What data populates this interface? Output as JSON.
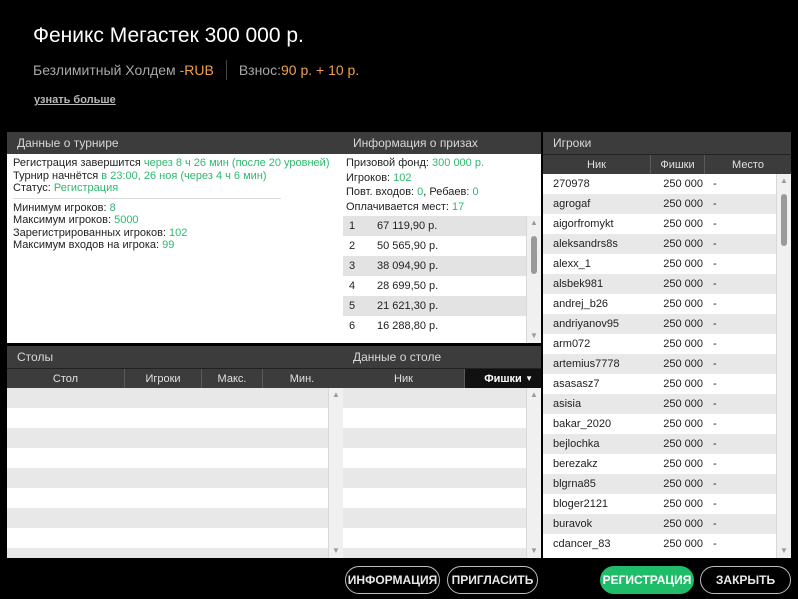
{
  "header": {
    "title": "Феникс Мегастек 300 000 р.",
    "game_type": "Безлимитный Холдем - ",
    "currency": "RUB",
    "buyin_label": "Взнос: ",
    "buyin_value": "90 р. + 10 р.",
    "more_link": "узнать больше"
  },
  "tournament": {
    "heading": "Данные о турнире",
    "reg_label": "Регистрация завершится ",
    "reg_value": "через 8 ч 26 мин (после 20 уровней)",
    "start_label": "Турнир начнётся ",
    "start_value": "в 23:00, 26 ноя (через 4 ч 6 мин)",
    "status_label": "Статус: ",
    "status_value": "Регистрация",
    "min_label": "Минимум игроков: ",
    "min_value": "8",
    "max_label": "Максимум игроков: ",
    "max_value": "5000",
    "registered_label": "Зарегистрированных игроков: ",
    "registered_value": "102",
    "max_entries_label": "Максимум входов на игрока: ",
    "max_entries_value": "99"
  },
  "prizes": {
    "heading": "Информация о призах",
    "pool_label": "Призовой фонд: ",
    "pool_value": "300 000 р.",
    "players_label": "Игроков: ",
    "players_value": "102",
    "reentries_label": "Повт. входов: ",
    "reentries_value": "0",
    "rebuys_label": ", Ребаев: ",
    "rebuys_value": "0",
    "paid_label": "Оплачивается мест: ",
    "paid_value": "17",
    "rows": [
      {
        "place": "1",
        "amount": "67 119,90 р."
      },
      {
        "place": "2",
        "amount": "50 565,90 р."
      },
      {
        "place": "3",
        "amount": "38 094,90 р."
      },
      {
        "place": "4",
        "amount": "28 699,50 р."
      },
      {
        "place": "5",
        "amount": "21 621,30 р."
      },
      {
        "place": "6",
        "amount": "16 288,80 р."
      }
    ]
  },
  "players": {
    "heading": "Игроки",
    "col_nick": "Ник",
    "col_chips": "Фишки",
    "col_place": "Место",
    "rows": [
      {
        "nick": "270978",
        "chips": "250 000",
        "place": "-"
      },
      {
        "nick": "agrogaf",
        "chips": "250 000",
        "place": "-"
      },
      {
        "nick": "aigorfromykt",
        "chips": "250 000",
        "place": "-"
      },
      {
        "nick": "aleksandrs8s",
        "chips": "250 000",
        "place": "-"
      },
      {
        "nick": "alexx_1",
        "chips": "250 000",
        "place": "-"
      },
      {
        "nick": "alsbek981",
        "chips": "250 000",
        "place": "-"
      },
      {
        "nick": "andrej_b26",
        "chips": "250 000",
        "place": "-"
      },
      {
        "nick": "andriyanov95",
        "chips": "250 000",
        "place": "-"
      },
      {
        "nick": "arm072",
        "chips": "250 000",
        "place": "-"
      },
      {
        "nick": "artemius7778",
        "chips": "250 000",
        "place": "-"
      },
      {
        "nick": "asasasz7",
        "chips": "250 000",
        "place": "-"
      },
      {
        "nick": "asisia",
        "chips": "250 000",
        "place": "-"
      },
      {
        "nick": "bakar_2020",
        "chips": "250 000",
        "place": "-"
      },
      {
        "nick": "bejlochka",
        "chips": "250 000",
        "place": "-"
      },
      {
        "nick": "berezakz",
        "chips": "250 000",
        "place": "-"
      },
      {
        "nick": "blgrna85",
        "chips": "250 000",
        "place": "-"
      },
      {
        "nick": "bloger2121",
        "chips": "250 000",
        "place": "-"
      },
      {
        "nick": "buravok",
        "chips": "250 000",
        "place": "-"
      },
      {
        "nick": "cdancer_83",
        "chips": "250 000",
        "place": "-"
      }
    ]
  },
  "tables": {
    "heading": "Столы",
    "col_table": "Стол",
    "col_players": "Игроки",
    "col_max": "Макс.",
    "col_min": "Мин."
  },
  "table_data": {
    "heading": "Данные о столе",
    "col_nick": "Ник",
    "col_chips": "Фишки"
  },
  "buttons": {
    "info": "ИНФОРМАЦИЯ",
    "invite": "ПРИГЛАСИТЬ",
    "register": "РЕГИСТРАЦИЯ",
    "close": "ЗАКРЫТЬ"
  },
  "icons": {
    "scroll_up": "scroll-up-arrow-icon",
    "scroll_down": "scroll-down-arrow-icon",
    "sort": "sort-down-icon"
  }
}
